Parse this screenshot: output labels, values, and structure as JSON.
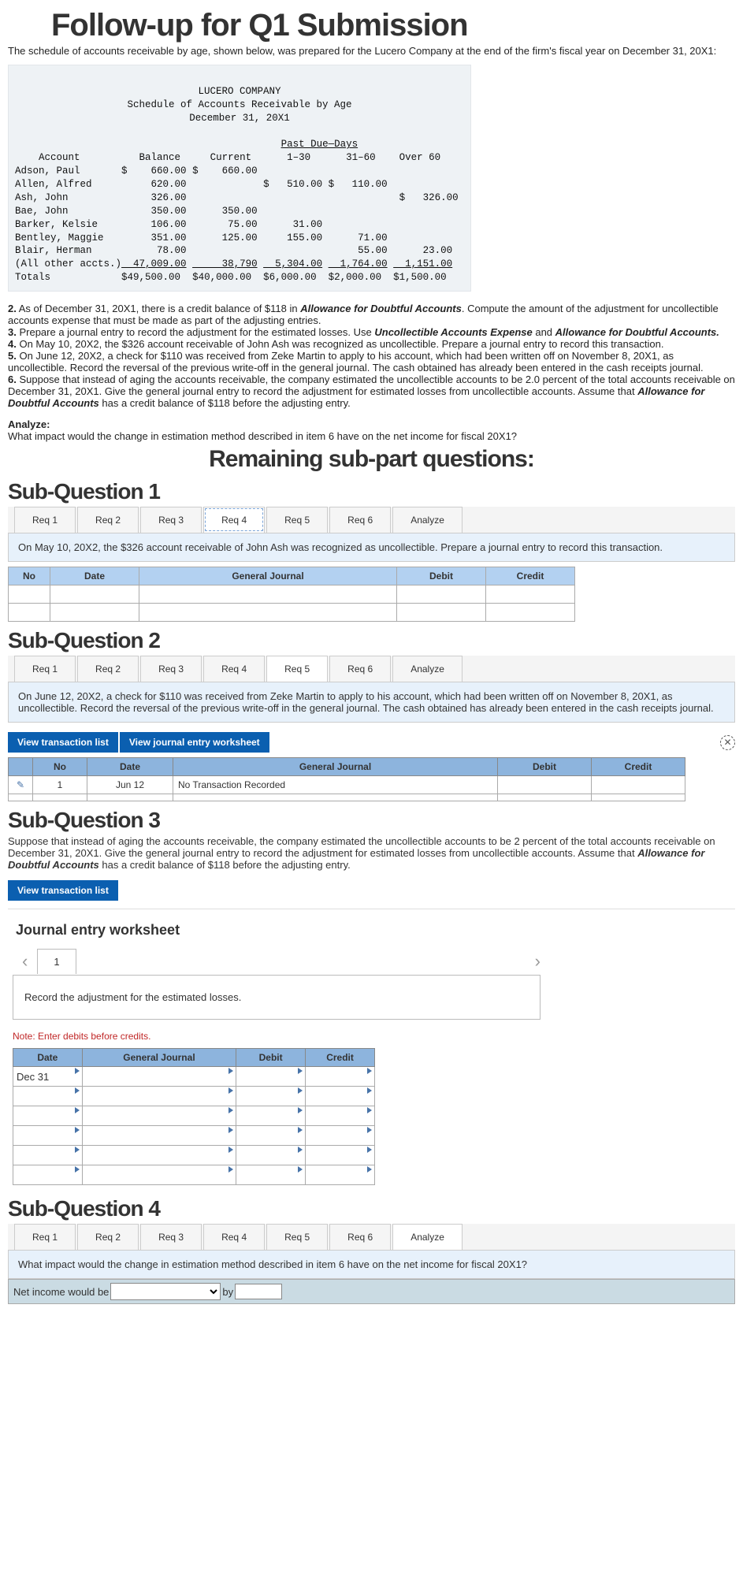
{
  "title": "Follow-up for Q1 Submission",
  "intro": "The schedule of accounts receivable by age, shown below, was prepared for the Lucero Company at the end of the firm's fiscal year on December 31, 20X1:",
  "ledger": {
    "company": "LUCERO COMPANY",
    "subtitle": "Schedule of Accounts Receivable by Age",
    "date": "December 31, 20X1",
    "pastdue_header": "Past Due—Days",
    "cols": {
      "account": "Account",
      "balance": "Balance",
      "current": "Current",
      "c1_30": "1–30",
      "c31_60": "31–60",
      "over60": "Over 60"
    },
    "rows": [
      {
        "acct": "Adson, Paul",
        "bal": "$    660.00",
        "cur": "$    660.00",
        "d1": "",
        "d2": "",
        "d3": ""
      },
      {
        "acct": "Allen, Alfred",
        "bal": "     620.00",
        "cur": "",
        "d1": "$   510.00",
        "d2": "$   110.00",
        "d3": ""
      },
      {
        "acct": "Ash, John",
        "bal": "     326.00",
        "cur": "",
        "d1": "",
        "d2": "",
        "d3": "$   326.00"
      },
      {
        "acct": "Bae, John",
        "bal": "     350.00",
        "cur": "     350.00",
        "d1": "",
        "d2": "",
        "d3": ""
      },
      {
        "acct": "Barker, Kelsie",
        "bal": "     106.00",
        "cur": "      75.00",
        "d1": "     31.00",
        "d2": "",
        "d3": ""
      },
      {
        "acct": "Bentley, Maggie",
        "bal": "     351.00",
        "cur": "     125.00",
        "d1": "    155.00",
        "d2": "     71.00",
        "d3": ""
      },
      {
        "acct": "Blair, Herman",
        "bal": "      78.00",
        "cur": "",
        "d1": "",
        "d2": "     55.00",
        "d3": "     23.00"
      },
      {
        "acct": "(All other accts.)",
        "bal": "  47,009.00",
        "cur": "     38,790",
        "d1": "  5,304.00",
        "d2": "  1,764.00",
        "d3": "  1,151.00"
      }
    ],
    "totals": {
      "lbl": "Totals",
      "bal": "$49,500.00",
      "cur": "$40,000.00",
      "d1": "$6,000.00",
      "d2": "$2,000.00",
      "d3": "$1,500.00"
    }
  },
  "items": {
    "i2": "As of December 31, 20X1, there is a credit balance of $118 in ",
    "i2b": "Allowance for Doubtful Accounts",
    "i2c": ". Compute the amount of the adjustment for uncollectible accounts expense that must be made as part of the adjusting entries.",
    "i3": "Prepare a journal entry to record the adjustment for the estimated losses. Use ",
    "i3b": "Uncollectible Accounts Expense",
    "i3c": " and ",
    "i3d": "Allowance for Doubtful Accounts.",
    "i4": "On May 10, 20X2, the $326 account receivable of John Ash was recognized as uncollectible. Prepare a journal entry to record this transaction.",
    "i5": "On June 12, 20X2, a check for $110 was received from Zeke Martin to apply to his account, which had been written off on November 8, 20X1, as uncollectible. Record the reversal of the previous write-off in the general journal. The cash obtained has already been entered in the cash receipts journal.",
    "i6a": "Suppose that instead of aging the accounts receivable, the company estimated the uncollectible accounts to be 2.0 percent of the total accounts receivable on December 31, 20X1. Give the general journal entry to record the adjustment for estimated losses from uncollectible accounts. Assume that ",
    "i6b": "Allowance for Doubtful Accounts",
    "i6c": " has a credit balance of $118 before the adjusting entry."
  },
  "analyze": {
    "lbl": "Analyze:",
    "q": "What impact would the change in estimation method described in item 6 have on the net income for fiscal 20X1?"
  },
  "remaining": "Remaining sub-part questions:",
  "tabs": [
    "Req 1",
    "Req 2",
    "Req 3",
    "Req 4",
    "Req 5",
    "Req 6",
    "Analyze"
  ],
  "sq1": {
    "title": "Sub-Question 1",
    "desc": "On May 10, 20X2, the $326 account receivable of John Ash was recognized as uncollectible. Prepare a journal entry to record this transaction.",
    "cols": {
      "no": "No",
      "date": "Date",
      "gj": "General Journal",
      "debit": "Debit",
      "credit": "Credit"
    }
  },
  "sq2": {
    "title": "Sub-Question 2",
    "desc": "On June 12, 20X2, a check for $110 was received from Zeke Martin to apply to his account, which had been written off on November 8, 20X1, as uncollectible. Record the reversal of the previous write-off in the general journal. The cash obtained has already been entered in the cash receipts journal.",
    "btn1": "View transaction list",
    "btn2": "View journal entry worksheet",
    "cols": {
      "no": "No",
      "date": "Date",
      "gj": "General Journal",
      "debit": "Debit",
      "credit": "Credit"
    },
    "row": {
      "no": "1",
      "date": "Jun 12",
      "gj": "No Transaction Recorded"
    }
  },
  "sq3": {
    "title": "Sub-Question 3",
    "desc1": "Suppose that instead of aging the accounts receivable, the company estimated the uncollectible accounts to be 2 percent of the total accounts receivable on December 31, 20X1. Give the general journal entry to record the adjustment for estimated losses from uncollectible accounts. Assume that ",
    "desc_b": "Allowance for Doubtful Accounts",
    "desc2": " has a credit balance of $118 before the adjusting entry.",
    "btn": "View transaction list",
    "ws_title": "Journal entry worksheet",
    "page": "1",
    "record": "Record the adjustment for the estimated losses.",
    "note": "Note: Enter debits before credits.",
    "cols": {
      "date": "Date",
      "gj": "General Journal",
      "debit": "Debit",
      "credit": "Credit"
    },
    "date": "Dec 31"
  },
  "sq4": {
    "title": "Sub-Question 4",
    "desc": "What impact would the change in estimation method described in item 6 have on the net income for fiscal 20X1?",
    "lbl": "Net income would be",
    "by": "by"
  }
}
